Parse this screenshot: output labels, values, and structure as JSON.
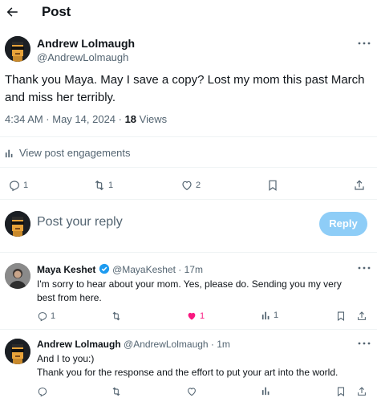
{
  "header": {
    "title": "Post"
  },
  "post": {
    "author_name": "Andrew Lolmaugh",
    "author_handle": "@AndrewLolmaugh",
    "text": "Thank you Maya. May I save a copy? Lost my mom this past March and miss her terribly.",
    "timestamp": "4:34 AM · May 14, 2024 · ",
    "views_count": "18",
    "views_label": " Views",
    "engagements_label": "View post engagements",
    "actions": {
      "replies": "1",
      "reposts": "1",
      "likes": "2"
    }
  },
  "compose": {
    "placeholder": "Post your reply",
    "reply_label": "Reply"
  },
  "replies": [
    {
      "author_name": "Maya Keshet",
      "author_handle": "@MayaKeshet",
      "time": " · 17m",
      "text": "I'm sorry to hear about your mom. Yes, please do. Sending you my very best from here.",
      "actions": {
        "replies": "1",
        "reposts": "",
        "likes": "1",
        "views": "1"
      },
      "liked": true
    },
    {
      "author_name": "Andrew Lolmaugh",
      "author_handle": "@AndrewLolmaugh",
      "time": " · 1m",
      "text_line1": "And I to you:)",
      "text_line2": "Thank you for the response and the effort to put your art into the world.",
      "actions": {
        "replies": "",
        "reposts": "",
        "likes": "",
        "views": ""
      },
      "liked": false
    }
  ],
  "colors": {
    "accent": "#1d9bf0",
    "like": "#f91880",
    "reply_button_disabled": "#8ecdf7",
    "muted": "#536471"
  }
}
